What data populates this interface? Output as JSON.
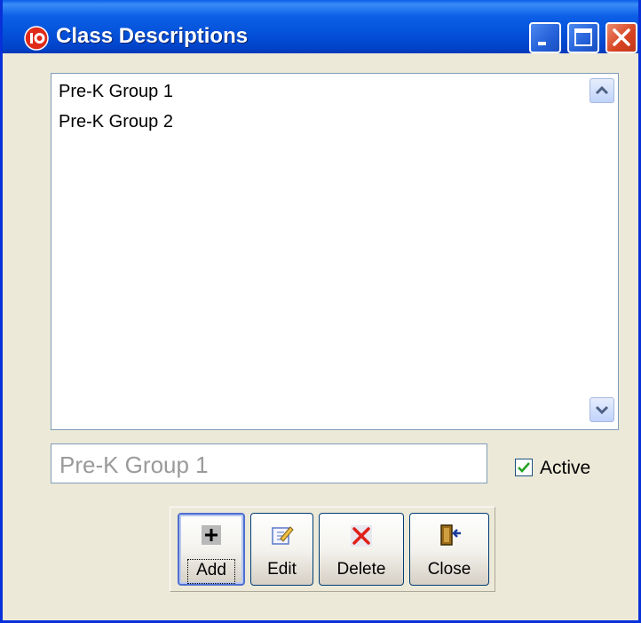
{
  "window": {
    "title": "Class Descriptions"
  },
  "list": {
    "items": [
      "Pre-K Group 1",
      "Pre-K Group 2"
    ]
  },
  "editor": {
    "value": "Pre-K Group 1",
    "active_label": "Active",
    "active_checked": true
  },
  "buttons": {
    "add": "Add",
    "edit": "Edit",
    "delete": "Delete",
    "close": "Close"
  },
  "colors": {
    "titlebar": "#0553db",
    "window_bg": "#ece9d8",
    "close_button": "#d64320"
  }
}
